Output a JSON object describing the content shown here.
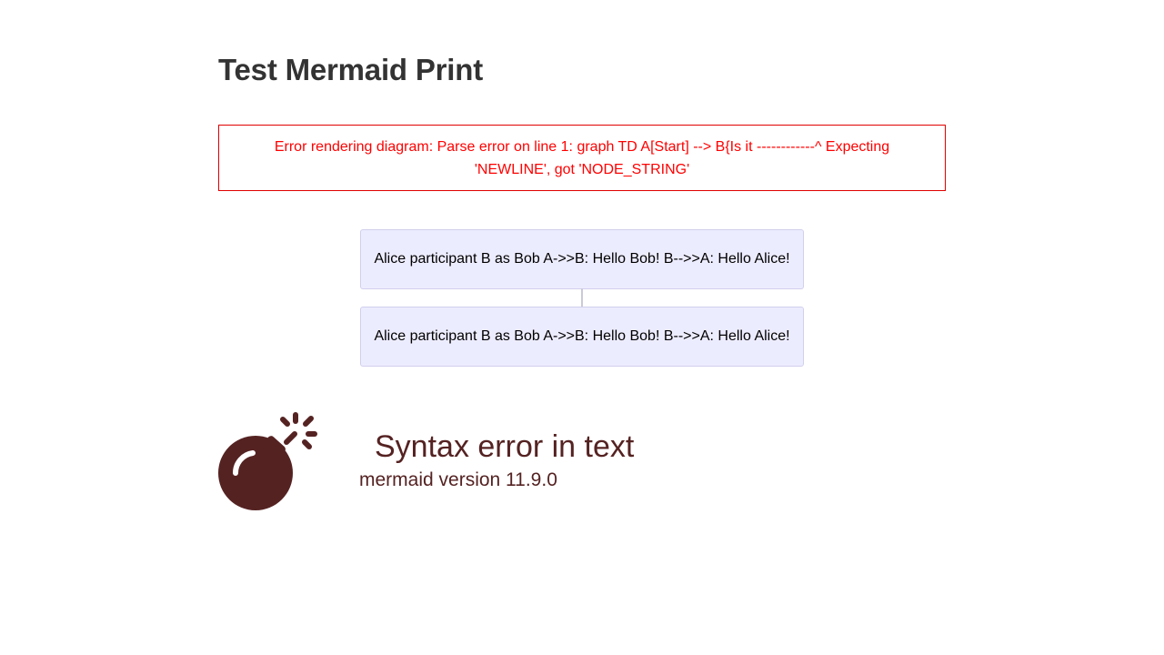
{
  "page": {
    "title": "Test Mermaid Print"
  },
  "error": {
    "message": "Error rendering diagram: Parse error on line 1: graph TD A[Start] --> B{Is it ------------^ Expecting 'NEWLINE', got 'NODE_STRING'",
    "color": "#ff0000"
  },
  "diagram": {
    "nodes": [
      {
        "label": "Alice participant B as Bob A->>B: Hello Bob! B-->>A: Hello Alice!"
      },
      {
        "label": "Alice participant B as Bob A->>B: Hello Bob! B-->>A: Hello Alice!"
      }
    ],
    "node_fill": "#ececff",
    "node_border": "#d1cfec"
  },
  "syntax_error": {
    "icon": "bomb-icon",
    "text": "Syntax error in text",
    "version": "mermaid version 11.9.0",
    "color": "#552222"
  }
}
